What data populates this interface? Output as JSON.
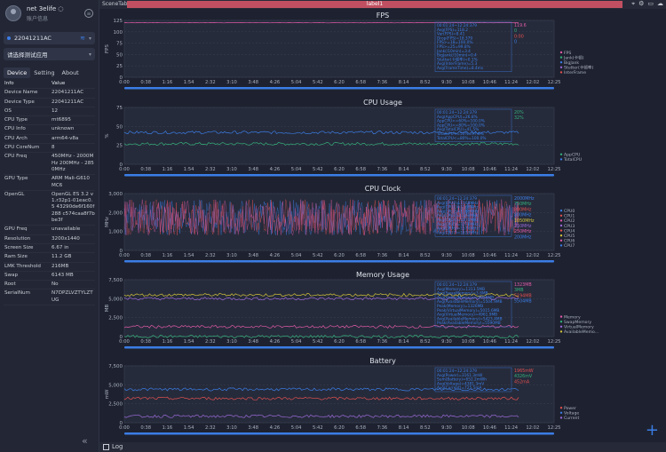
{
  "profile": {
    "name": "net 3elife ◌",
    "subtitle": "账户信息"
  },
  "device": {
    "label": "22041211AC"
  },
  "app_select": {
    "label": "请选择测试应用"
  },
  "tabs": [
    "Device",
    "Setting",
    "About"
  ],
  "info": {
    "header": {
      "k": "Info",
      "v": "Value"
    },
    "rows": [
      {
        "k": "Device Name",
        "v": "22041211AC"
      },
      {
        "k": "Device Type",
        "v": "22041211AC"
      },
      {
        "k": "OS",
        "v": "12"
      },
      {
        "k": "CPU Type",
        "v": "mt6895"
      },
      {
        "k": "CPU Info",
        "v": "unknown"
      },
      {
        "k": "CPU Arch",
        "v": "arm64-v8a"
      },
      {
        "k": "CPU CoreNum",
        "v": "8"
      },
      {
        "k": "CPU Freq",
        "v": "450MHz - 2000MHz 200MHz - 2850MHz"
      },
      {
        "k": "GPU Type",
        "v": "ARM Mali-G610 MC6"
      },
      {
        "k": "OpenGL",
        "v": "OpenGL ES 3.2 v1.r32p1-01eac0.5 43290de6f160f288 c574caa8f7bbe3f"
      },
      {
        "k": "GPU Freq",
        "v": "unavailable"
      },
      {
        "k": "Resolution",
        "v": "3200x1440"
      },
      {
        "k": "Screen Size",
        "v": "6.67 in"
      },
      {
        "k": "Ram Size",
        "v": "11.2 GB"
      },
      {
        "k": "LMK Threshold",
        "v": "216MB"
      },
      {
        "k": "Swap",
        "v": "6143 MB"
      },
      {
        "k": "Root",
        "v": "No"
      },
      {
        "k": "SerialNum",
        "v": "N7DPZLVZTYLZTUG"
      }
    ]
  },
  "topbar": {
    "scene_tab": "SceneTab",
    "label": "label1"
  },
  "bottombar": {
    "log_label": "Log"
  },
  "x_ticks": [
    "0:00",
    "0:38",
    "1:16",
    "1:54",
    "2:32",
    "3:10",
    "3:48",
    "4:26",
    "5:04",
    "5:42",
    "6:20",
    "6:58",
    "7:36",
    "8:14",
    "8:52",
    "9:30",
    "10:08",
    "10:46",
    "11:24",
    "12:02",
    "12:25"
  ],
  "colors": {
    "blue": "#3b7de6",
    "pink": "#e05aa8",
    "green": "#35b07a",
    "red": "#e05050",
    "yellow": "#d4c43a",
    "purple": "#9b6ad9"
  },
  "chart_data": [
    {
      "type": "line",
      "title": "FPS",
      "ylabel": "FPS",
      "ylim": [
        0,
        125
      ],
      "yticks": [
        "125",
        "100",
        "75",
        "50",
        "25",
        "0"
      ],
      "series": [
        {
          "name": "FPS",
          "color": "#e05aa8",
          "level": 120
        }
      ],
      "legend": [
        "FPS",
        "Jank(卡顿)",
        "BigJank",
        "Stutter(卡顿率)",
        "InterFrame"
      ],
      "overlay": [
        "00:01:24~12:24:379",
        "Avg(FPS)=118.2",
        "Var(FPS)=8.41",
        "Drop(FPS)=18.379",
        "FPS>=18=100.0%",
        "FPS>=25=99.8%",
        "Jank(/10min)=3.4",
        "BigJank(/10min)=0.4",
        "Stutter(卡顿率)=0.1%",
        "Avg(InterFrame)=5.3",
        "Avg(FrameTime)=8.4ms"
      ],
      "right_values": [
        "119.6",
        "0",
        "0:00",
        "0"
      ]
    },
    {
      "type": "line",
      "title": "CPU Usage",
      "ylabel": "%",
      "ylim": [
        0,
        75
      ],
      "yticks": [
        "75",
        "50",
        "25",
        "0"
      ],
      "series": [
        {
          "name": "AppCPU",
          "color": "#35b07a",
          "level": 27
        },
        {
          "name": "TotalCPU",
          "color": "#3b7de6",
          "level": 42
        }
      ],
      "legend": [
        "AppCPU",
        "TotalCPU"
      ],
      "overlay": [
        "00:01:24~12:24:379",
        "Avg(AppCPU)=26.8%",
        "AppCPU<=60%=100.0%",
        "AppCPU<=80%=100.0%",
        "Avg(TotalCPU)=41.5%",
        "TotalCPU<=50%=97.8%",
        "TotalCPU<=80%=100.0%"
      ],
      "right_values": [
        "20%",
        "32%"
      ]
    },
    {
      "type": "line",
      "title": "CPU Clock",
      "ylabel": "MHz",
      "ylim": [
        0,
        3000
      ],
      "yticks": [
        "3,000",
        "2,000",
        "1,000",
        "0"
      ],
      "series": [
        {
          "name": "CPU0",
          "color": "#3b7de6"
        },
        {
          "name": "CPU4",
          "color": "#e05050"
        },
        {
          "name": "CPU7",
          "color": "#e05aa8"
        }
      ],
      "legend": [
        "CPU0",
        "CPU1",
        "CPU2",
        "CPU3",
        "CPU4",
        "CPU5",
        "CPU6",
        "CPU7"
      ],
      "overlay": [
        "00:01:24~12:24:379",
        "Avg(CPU0)=1168MHz",
        "Avg(CPU1)=1168MHz",
        "Avg(CPU2)=1168MHz",
        "Avg(CPU3)=1168MHz",
        "Avg(CPU4)=1576MHz",
        "Avg(CPU5)=1576MHz",
        "Avg(CPU6)=1576MHz",
        "Avg(CPU7)=1633MHz"
      ],
      "right_values": [
        "2000MHz",
        "750MHz",
        "800MHz",
        "800MHz",
        "1050MHz",
        "250MHz",
        "250MHz",
        "200MHz"
      ]
    },
    {
      "type": "line",
      "title": "Memory Usage",
      "ylabel": "MB",
      "ylim": [
        0,
        7500
      ],
      "yticks": [
        "7,500",
        "5,000",
        "2,500",
        "0"
      ],
      "series": [
        {
          "name": "Memory",
          "color": "#e05aa8",
          "level": 1300
        },
        {
          "name": "SwapMemory",
          "color": "#35b07a",
          "level": 5
        },
        {
          "name": "VirtualMemory",
          "color": "#9b6ad9",
          "level": 5000
        },
        {
          "name": "AvailableMemory",
          "color": "#d4c43a",
          "level": 5500
        }
      ],
      "legend": [
        "Memory",
        "SwapMemory",
        "VirtualMemory",
        "AvailableMemo..."
      ],
      "overlay": [
        "00:01:24~12:24:379",
        "Avg(Memory)=1313.5MB",
        "Avg(SwapMemory)=3.8MB",
        "Avg(VirtualMemory)=5056MB",
        "Avg(AvailableMemory)=5504.9MB",
        "Peak(Memory)=1326MB",
        "Peak(VirtualMemory)=5015.6MB",
        "Avg(VirtualMemory)=4961.9MB",
        "Avg(AvailableMemory)=5423.4MB",
        "Peak(AvailableMemory)=5590MB"
      ],
      "right_values": [
        "1323MB",
        "3MB",
        "5194MB",
        "5504MB"
      ]
    },
    {
      "type": "line",
      "title": "Battery",
      "ylabel": "mW",
      "ylim": [
        0,
        7500
      ],
      "yticks": [
        "7,500",
        "5,000",
        "2,500",
        "0"
      ],
      "series": [
        {
          "name": "Power",
          "color": "#e05050",
          "level": 3200
        },
        {
          "name": "Voltage",
          "color": "#3b7de6",
          "level": 4400
        },
        {
          "name": "Current",
          "color": "#9b6ad9",
          "level": 850
        }
      ],
      "legend": [
        "Power",
        "Voltage",
        "Current"
      ],
      "overlay": [
        "00:01:24~12:24:379",
        "Avg(Power)=3161.3mW",
        "Sum(Battery)=652.2mWh",
        "Avg(Voltage)=4381.3mV",
        "Avg(Current)=725.5mA"
      ],
      "right_values": [
        "1965mW",
        "4326mV",
        "452mA"
      ]
    }
  ]
}
